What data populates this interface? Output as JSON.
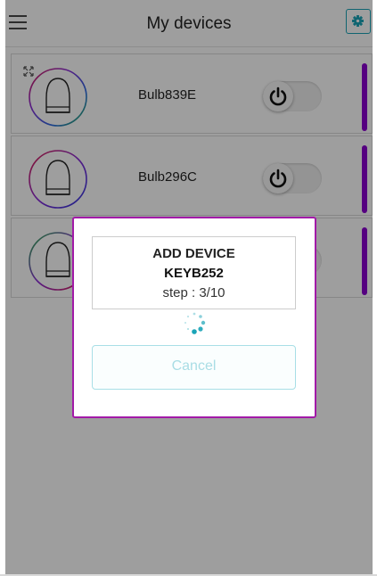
{
  "header": {
    "title": "My devices",
    "menu_icon": "hamburger-menu-icon",
    "settings_icon": "gear-icon",
    "accent_color": "#1aa4b7"
  },
  "devices": [
    {
      "name": "Bulb839E",
      "power_icon": "power-icon",
      "status_color": "#8a00cf",
      "expand_icon": "expand-arrows-icon"
    },
    {
      "name": "Bulb296C",
      "power_icon": "power-icon",
      "status_color": "#8a00cf"
    },
    {
      "name": "",
      "power_icon": "power-icon",
      "status_color": "#8a00cf"
    }
  ],
  "dialog": {
    "title": "ADD DEVICE",
    "device": "KEYB252",
    "step": "step : 3/10",
    "spinner_icon": "loading-spinner-icon",
    "cancel_label": "Cancel",
    "border_color": "#a21aa8"
  }
}
